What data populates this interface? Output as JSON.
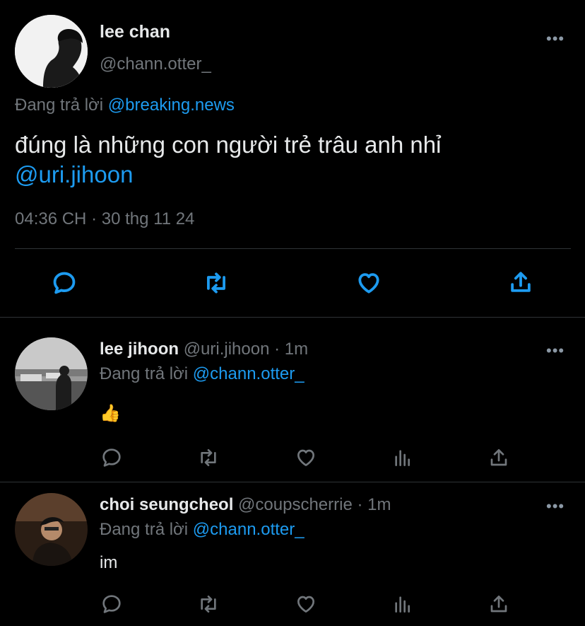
{
  "main_tweet": {
    "name": "lee chan",
    "handle": "@chann.otter_",
    "replying_prefix": "Đang trả lời",
    "replying_to": "@breaking.news",
    "text": "đúng là những con người trẻ trâu anh nhỉ",
    "mention": "@uri.jihoon",
    "time": "04:36 CH",
    "sep": "·",
    "date": "30 thg 11 24"
  },
  "replies": [
    {
      "name": "lee jihoon",
      "handle": "@uri.jihoon",
      "sep": "·",
      "time": "1m",
      "replying_prefix": "Đang trả lời",
      "replying_to": "@chann.otter_",
      "text": "👍"
    },
    {
      "name": "choi seungcheol",
      "handle": "@coupscherrie",
      "sep": "·",
      "time": "1m",
      "replying_prefix": "Đang trả lời",
      "replying_to": "@chann.otter_",
      "text": "im"
    }
  ],
  "more_label": "•••",
  "icons": [
    "reply-icon",
    "retweet-icon",
    "like-icon",
    "views-icon",
    "share-icon",
    "more-icon"
  ],
  "colors": {
    "background": "#000000",
    "text": "#e7e9ea",
    "secondary": "#71767b",
    "accent": "#1d9bf0",
    "divider": "#2f3336"
  }
}
